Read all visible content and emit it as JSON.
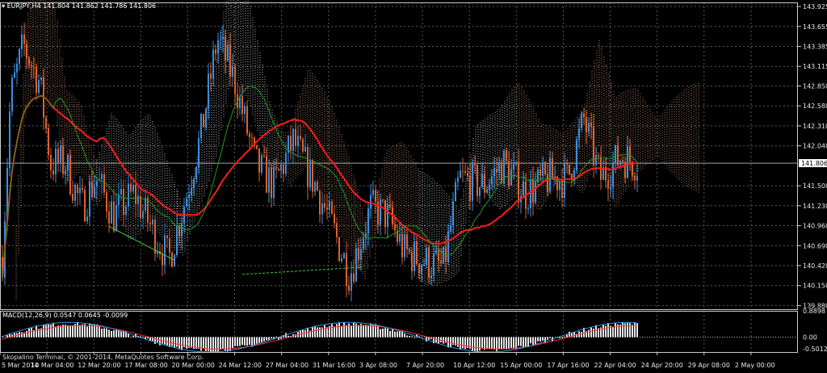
{
  "header": {
    "symbol": "EURJPY,H4",
    "open": "141.804",
    "high": "141.862",
    "low": "141.786",
    "close": "141.806",
    "menu_icon": "triangle-down-icon"
  },
  "price_axis": {
    "labels": [
      "143.925",
      "143.655",
      "143.385",
      "143.115",
      "142.850",
      "142.580",
      "142.310",
      "142.040",
      "141.500",
      "141.230",
      "140.960",
      "140.690",
      "140.420",
      "140.150",
      "139.880"
    ],
    "current_price": "141.806"
  },
  "indicator": {
    "label": "MACD(12,26,9) 0.0547 0.0645 -0.0099",
    "axis_labels": [
      "0.8898",
      "0.00",
      "-0.5012"
    ]
  },
  "footer": {
    "copyright": "Skopalino Terminal, © 2001-2014, MetaQuotes Software Corp."
  },
  "time_axis": {
    "labels": [
      "5 Mar 2014",
      "10 Mar 04:00",
      "12 Mar 20:00",
      "17 Mar 08:00",
      "20 Mar 00:00",
      "24 Mar 12:00",
      "27 Mar 04:00",
      "31 Mar 16:00",
      "3 Apr 08:00",
      "7 Apr 20:00",
      "10 Apr 12:00",
      "15 Apr 00:00",
      "17 Apr 16:00",
      "22 Apr 04:00",
      "24 Apr 20:00",
      "29 Apr 08:00",
      "2 May 00:00"
    ]
  },
  "colors": {
    "background": "#000000",
    "grid": "#5a5a5a",
    "bull_candle": "#3a8fe0",
    "bear_candle": "#e0622a",
    "ma_red": "#ff1a1a",
    "ma_green": "#1f9a1f",
    "cloud_a": "#f0b090",
    "cloud_b": "#f0f0f0",
    "macd_hist": "#e8e8e8",
    "macd_signal": "#ff3030",
    "macd_line": "#3a8fe0",
    "divergence": "#3bd13b",
    "price_line": "#9aa4b0"
  }
}
